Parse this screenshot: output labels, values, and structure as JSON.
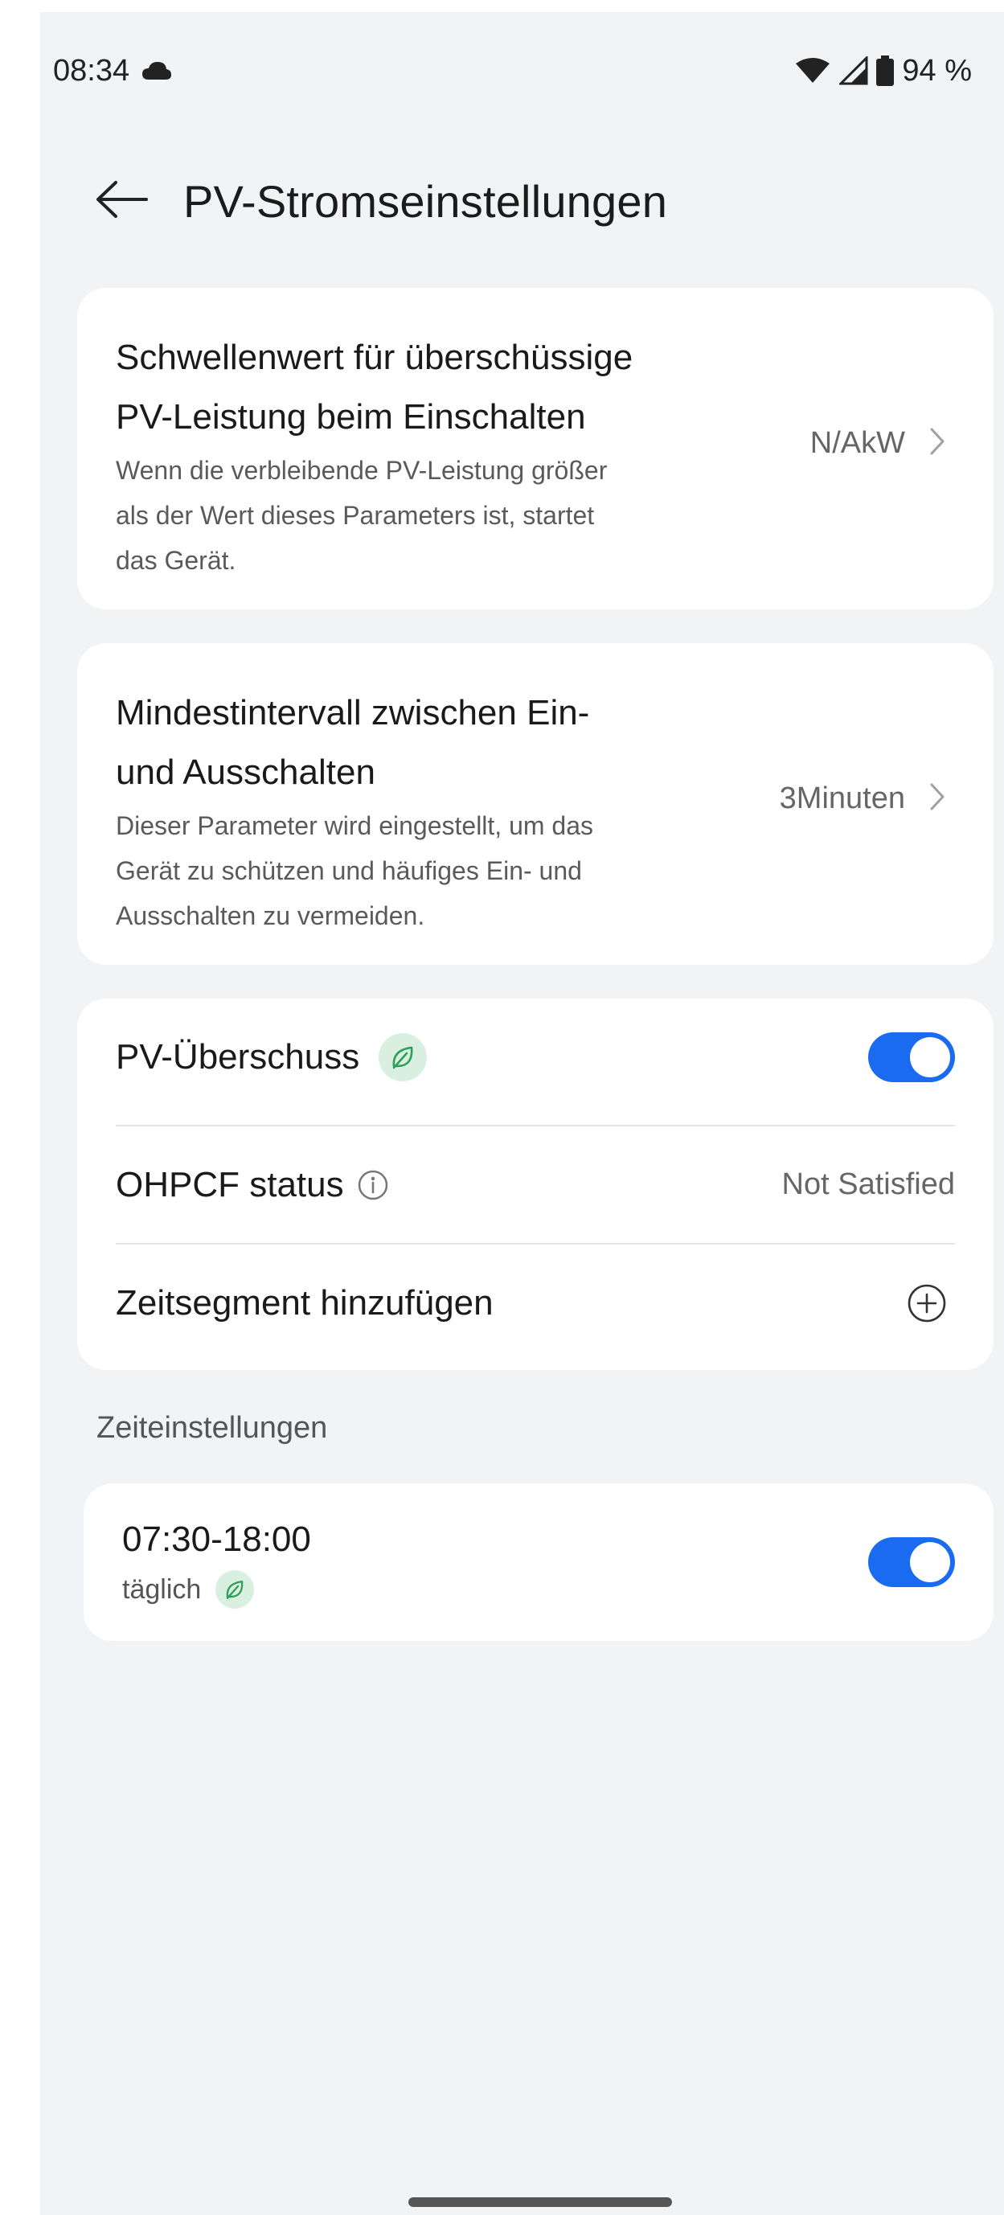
{
  "status_bar": {
    "time": "08:34",
    "battery": "94 %",
    "icons": [
      "cloud-icon",
      "wifi-icon",
      "cell-signal-icon",
      "battery-icon"
    ]
  },
  "header": {
    "title": "PV-Stromseinstellungen",
    "back_icon": "back-arrow-icon"
  },
  "settings": {
    "threshold": {
      "title_line1": "Schwellenwert für überschüssige",
      "title_line2": "PV-Leistung beim Einschalten",
      "desc_line1": "Wenn die verbleibende PV-Leistung größer",
      "desc_line2": "als der Wert dieses Parameters ist, startet",
      "desc_line3": "das Gerät.",
      "value": "N/AkW"
    },
    "interval": {
      "title_line1": "Mindestintervall zwischen Ein-",
      "title_line2": "und Ausschalten",
      "desc_line1": "Dieser Parameter wird eingestellt, um das",
      "desc_line2": "Gerät zu schützen und häufiges Ein- und",
      "desc_line3": "Ausschalten zu vermeiden.",
      "value": "3Minuten"
    }
  },
  "pv_card": {
    "surplus_label": "PV-Überschuss",
    "surplus_enabled": true,
    "ohpcf_label": "OHPCF status",
    "ohpcf_value": "Not Satisfied",
    "add_segment_label": "Zeitsegment hinzufügen"
  },
  "time_settings": {
    "section_label": "Zeiteinstellungen",
    "items": [
      {
        "time_range": "07:30-18:00",
        "repeat": "täglich",
        "enabled": true
      }
    ]
  },
  "colors": {
    "accent": "#1a6bf0",
    "leaf_green": "#2e9e58",
    "background": "#f1f3f5"
  }
}
